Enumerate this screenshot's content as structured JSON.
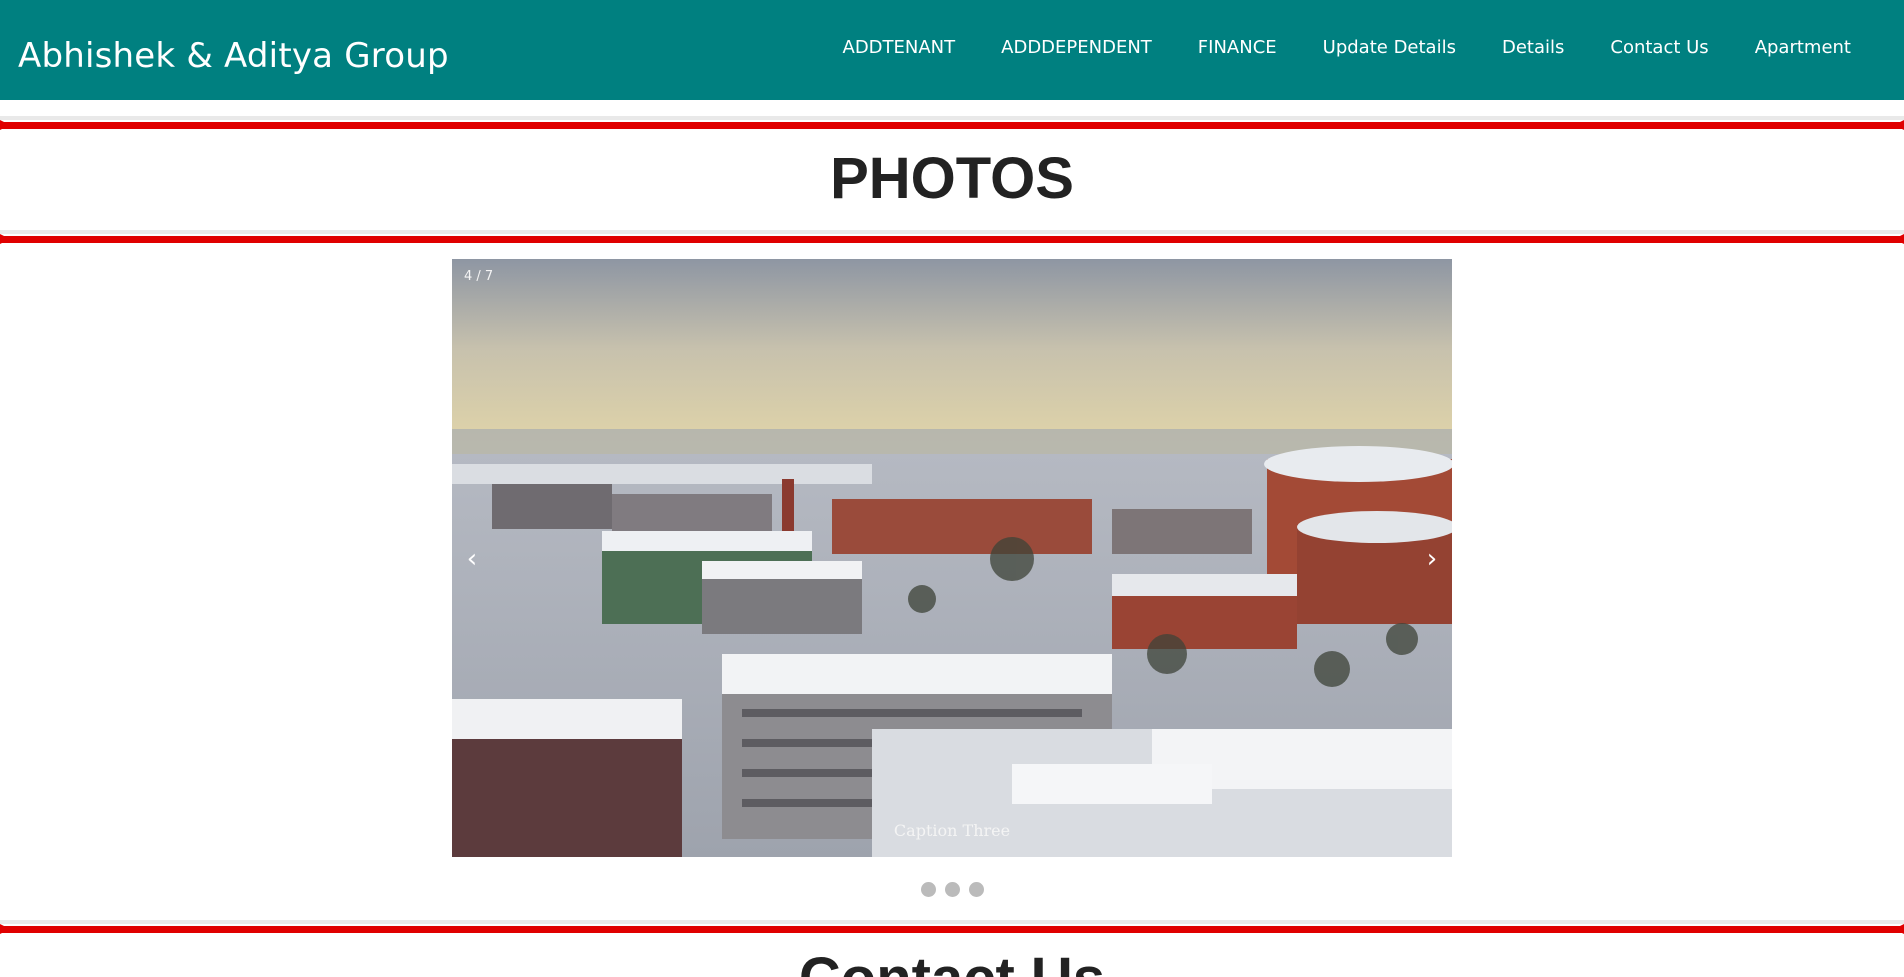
{
  "header": {
    "brand": "Abhishek & Aditya Group",
    "nav": [
      {
        "label": "ADDTENANT"
      },
      {
        "label": "ADDDEPENDENT"
      },
      {
        "label": "FINANCE"
      },
      {
        "label": "Update Details"
      },
      {
        "label": "Details"
      },
      {
        "label": "Contact Us"
      },
      {
        "label": "Apartment"
      }
    ]
  },
  "photos": {
    "title": "PHOTOS",
    "slideshow": {
      "counter": "4 / 7",
      "prev_icon": "‹",
      "next_icon": "›",
      "caption": "Caption Three",
      "dots": 3
    }
  },
  "contact": {
    "title": "Contact Us"
  },
  "colors": {
    "header_bg": "#008080",
    "rule_red": "#e00000",
    "dot_grey": "#bbbbbb"
  }
}
